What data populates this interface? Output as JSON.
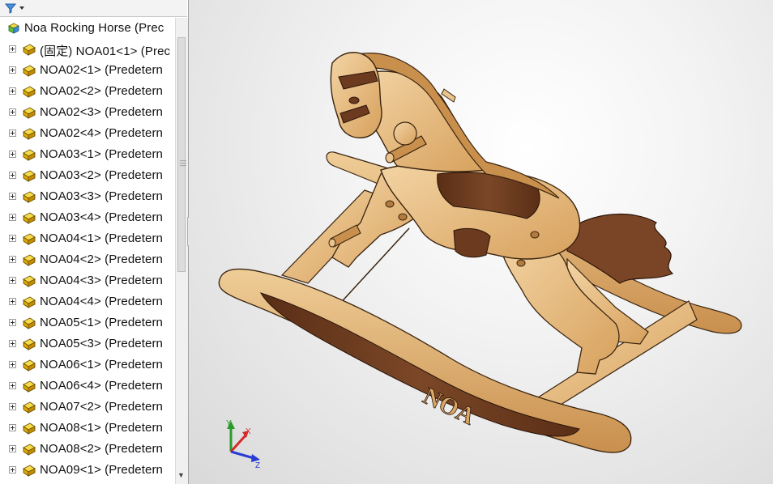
{
  "filter": {
    "icon": "funnel-icon",
    "dropdown_icon": "dropdown-arrow-icon"
  },
  "tree": {
    "root": {
      "label": "Noa Rocking Horse  (Prec",
      "icon": "assembly-icon"
    },
    "items": [
      {
        "label": "(固定) NOA01<1> (Prec"
      },
      {
        "label": "NOA02<1> (Predetern"
      },
      {
        "label": "NOA02<2> (Predetern"
      },
      {
        "label": "NOA02<3> (Predetern"
      },
      {
        "label": "NOA02<4> (Predetern"
      },
      {
        "label": "NOA03<1> (Predetern"
      },
      {
        "label": "NOA03<2> (Predetern"
      },
      {
        "label": "NOA03<3> (Predetern"
      },
      {
        "label": "NOA03<4> (Predetern"
      },
      {
        "label": "NOA04<1> (Predetern"
      },
      {
        "label": "NOA04<2> (Predetern"
      },
      {
        "label": "NOA04<3> (Predetern"
      },
      {
        "label": "NOA04<4> (Predetern"
      },
      {
        "label": "NOA05<1> (Predetern"
      },
      {
        "label": "NOA05<3> (Predetern"
      },
      {
        "label": "NOA06<1> (Predetern"
      },
      {
        "label": "NOA06<4> (Predetern"
      },
      {
        "label": "NOA07<2> (Predetern"
      },
      {
        "label": "NOA08<1> (Predetern"
      },
      {
        "label": "NOA08<2> (Predetern"
      },
      {
        "label": "NOA09<1> (Predetern"
      }
    ]
  },
  "viewport": {
    "engraving": "NOA",
    "triad": {
      "x": "X",
      "y": "Y",
      "z": "Z"
    }
  },
  "colors": {
    "wood_light": "#e9c48e",
    "wood_mid": "#d9a765",
    "wood_dark": "#6b3a1f",
    "edge_line": "#3a2410",
    "axis_x": "#d42a2a",
    "axis_y": "#2a9a2a",
    "axis_z": "#2a3ad4",
    "part_icon": "#e0a800"
  }
}
